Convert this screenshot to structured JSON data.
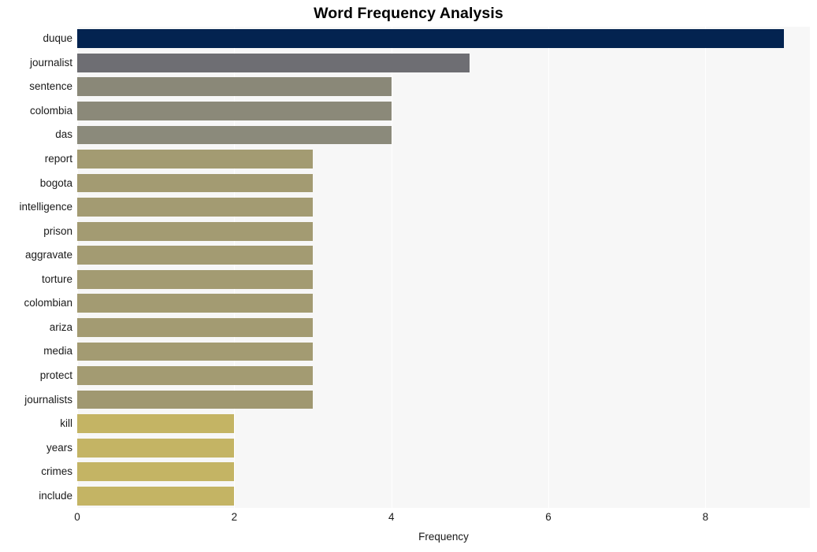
{
  "chart_data": {
    "type": "bar",
    "orientation": "horizontal",
    "title": "Word Frequency Analysis",
    "xlabel": "Frequency",
    "ylabel": "",
    "xlim": [
      0,
      9.33
    ],
    "xticks": [
      0,
      2,
      4,
      6,
      8
    ],
    "xticklabels": [
      "0",
      "2",
      "4",
      "6",
      "8"
    ],
    "grid": "vertical-only-white-on-gray",
    "legend": "none",
    "categories": [
      "duque",
      "journalist",
      "sentence",
      "colombia",
      "das",
      "report",
      "bogota",
      "intelligence",
      "prison",
      "aggravate",
      "torture",
      "colombian",
      "ariza",
      "media",
      "protect",
      "journalists",
      "kill",
      "years",
      "crimes",
      "include"
    ],
    "values": [
      9,
      5,
      4,
      4,
      4,
      3,
      3,
      3,
      3,
      3,
      3,
      3,
      3,
      3,
      3,
      3,
      2,
      2,
      2,
      2
    ],
    "bar_colors": [
      "#032350",
      "#6e6e73",
      "#8a8878",
      "#8b8979",
      "#8b8a7b",
      "#a39b72",
      "#a39b72",
      "#a39b72",
      "#a39b72",
      "#a39b72",
      "#a39b72",
      "#a39b72",
      "#a39b72",
      "#a39b72",
      "#a39b72",
      "#a09871",
      "#c4b464",
      "#c4b464",
      "#c4b464",
      "#c4b464"
    ],
    "plot_background": "#f7f7f7",
    "gridline_color": "#ffffff",
    "figure_background": "#ffffff",
    "text_color": "#1a1a1a",
    "title_color": "#000000"
  }
}
